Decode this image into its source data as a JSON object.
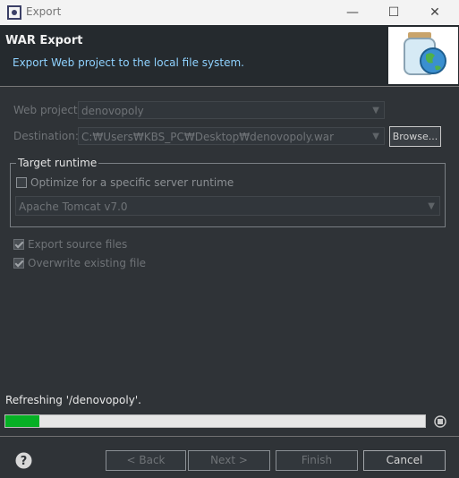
{
  "window": {
    "title": "Export",
    "controls": {
      "minimize": "—",
      "maximize": "☐",
      "close": "✕"
    }
  },
  "header": {
    "title": "WAR Export",
    "description": "Export Web project to the local file system."
  },
  "form": {
    "web_project": {
      "label": "Web project:",
      "value": "denovopoly"
    },
    "destination": {
      "label": "Destination:",
      "value": "C:₩Users₩KBS_PC₩Desktop₩denovopoly.war"
    },
    "browse_label": "Browse..."
  },
  "target_runtime": {
    "legend": "Target runtime",
    "optimize_label": "Optimize for a specific server runtime",
    "optimize_checked": false,
    "runtime_value": "Apache Tomcat v7.0"
  },
  "options": {
    "export_source": {
      "label": "Export source files",
      "checked": true
    },
    "overwrite": {
      "label": "Overwrite existing file",
      "checked": true
    }
  },
  "status": {
    "text": "Refreshing '/denovopoly'.",
    "progress": 0.08
  },
  "buttons": {
    "back": "< Back",
    "next": "Next >",
    "finish": "Finish",
    "cancel": "Cancel"
  },
  "colors": {
    "accent": "#8fd2ff",
    "progress": "#06b025",
    "background": "#2f3337"
  },
  "icons": {
    "app": "eclipse-icon",
    "header": "jar-globe-icon",
    "help": "help-icon",
    "stop": "stop-icon"
  }
}
